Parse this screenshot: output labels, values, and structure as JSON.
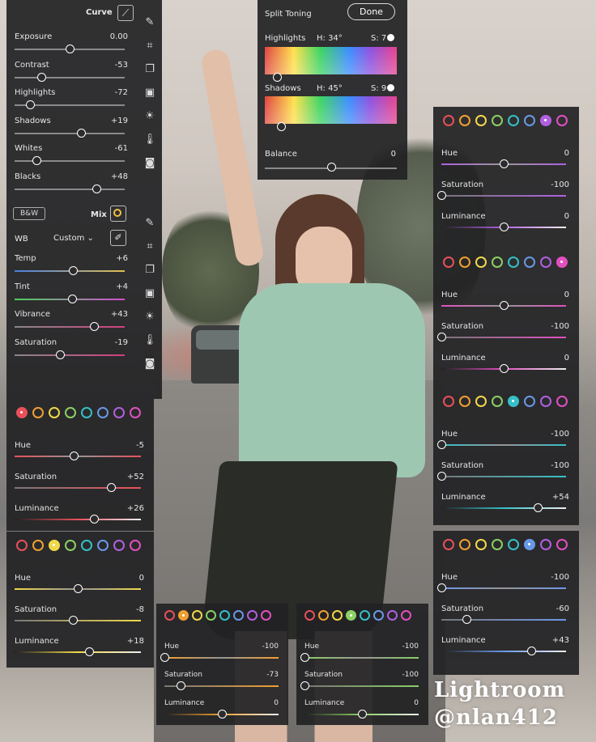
{
  "curve_panel": {
    "curve_label": "Curve",
    "sliders": [
      {
        "label": "Exposure",
        "value": "0.00",
        "pos": 0.5
      },
      {
        "label": "Contrast",
        "value": "-53",
        "pos": 0.24
      },
      {
        "label": "Highlights",
        "value": "-72",
        "pos": 0.14
      },
      {
        "label": "Shadows",
        "value": "+19",
        "pos": 0.6
      },
      {
        "label": "Whites",
        "value": "-61",
        "pos": 0.2
      },
      {
        "label": "Blacks",
        "value": "+48",
        "pos": 0.74
      }
    ]
  },
  "wb_panel": {
    "bw_label": "B&W",
    "mix_label": "Mix",
    "wb_label": "WB",
    "wb_value": "Custom",
    "sliders": [
      {
        "label": "Temp",
        "value": "+6",
        "pos": 0.53
      },
      {
        "label": "Tint",
        "value": "+4",
        "pos": 0.52
      },
      {
        "label": "Vibrance",
        "value": "+43",
        "pos": 0.72
      },
      {
        "label": "Saturation",
        "value": "-19",
        "pos": 0.41
      }
    ]
  },
  "split_toning": {
    "title": "Split Toning",
    "done_label": "Done",
    "highlights_label": "Highlights",
    "highlights_h": "H: 34°",
    "highlights_s": "S: 7",
    "shadows_label": "Shadows",
    "shadows_h": "H: 45°",
    "shadows_s": "S: 9",
    "balance_label": "Balance",
    "balance_value": "0",
    "balance_pos": 0.5
  },
  "colors": [
    "#e8505a",
    "#f0a030",
    "#f0d84a",
    "#8ad064",
    "#36c0c8",
    "#6a98e8",
    "#b060e0",
    "#e050c0"
  ],
  "hsl_panels": [
    {
      "id": "red",
      "selected": 0,
      "hue": "-5",
      "hue_pos": 0.47,
      "sat": "+52",
      "sat_pos": 0.76,
      "lum": "+26",
      "lum_pos": 0.63
    },
    {
      "id": "yellow",
      "selected": 2,
      "hue": "0",
      "hue_pos": 0.5,
      "sat": "-8",
      "sat_pos": 0.46,
      "lum": "+18",
      "lum_pos": 0.59
    },
    {
      "id": "orange",
      "selected": 1,
      "hue": "-100",
      "hue_pos": 0,
      "sat": "-73",
      "sat_pos": 0.14,
      "lum": "0",
      "lum_pos": 0.5
    },
    {
      "id": "green",
      "selected": 3,
      "hue": "-100",
      "hue_pos": 0,
      "sat": "-100",
      "sat_pos": 0,
      "lum": "0",
      "lum_pos": 0.5
    },
    {
      "id": "purple",
      "selected": 6,
      "hue": "0",
      "hue_pos": 0.5,
      "sat": "-100",
      "sat_pos": 0,
      "lum": "0",
      "lum_pos": 0.5
    },
    {
      "id": "magenta",
      "selected": 7,
      "hue": "0",
      "hue_pos": 0.5,
      "sat": "-100",
      "sat_pos": 0,
      "lum": "0",
      "lum_pos": 0.5
    },
    {
      "id": "aqua",
      "selected": 4,
      "hue": "-100",
      "hue_pos": 0,
      "sat": "-100",
      "sat_pos": 0,
      "lum": "+54",
      "lum_pos": 0.77
    },
    {
      "id": "blue",
      "selected": 5,
      "hue": "-100",
      "hue_pos": 0,
      "sat": "-60",
      "sat_pos": 0.2,
      "lum": "+43",
      "lum_pos": 0.72
    }
  ],
  "hsl_labels": {
    "hue": "Hue",
    "sat": "Saturation",
    "lum": "Luminance"
  },
  "brand": {
    "line1": "Lightroom",
    "line2": "@nlan412"
  }
}
